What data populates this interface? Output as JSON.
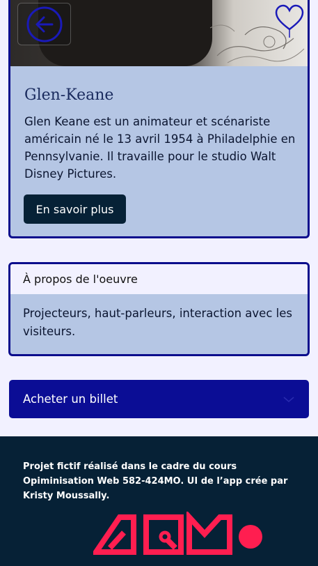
{
  "artist": {
    "name": "Glen-Keane",
    "bio": "Glen Keane est un animateur et scénariste américain né le 13 avril 1954 à Philadelphie en Pennsylvanie. Il travaille pour le studio Walt Disney Pictures.",
    "cta_label": "En savoir plus"
  },
  "nav": {
    "back_icon": "arrow-left-circle-icon",
    "favorite_icon": "heart-icon"
  },
  "work": {
    "heading": "À propos de l'oeuvre",
    "description": "Projecteurs, haut-parleurs, interaction avec les visiteurs."
  },
  "ticket": {
    "label": "Acheter un billet",
    "icon": "chevron-down-icon"
  },
  "footer": {
    "credit": "Projet fictif réalisé dans le cadre du cours Opiminisation Web 582-424MO. UI de l’app crée par Kristy Moussally."
  },
  "colors": {
    "accent": "#0b0d8c",
    "card_bg": "#b5c6e4",
    "page_bg": "#f2f1ff",
    "dark_navy": "#062136",
    "logo_red": "#ff1e50"
  }
}
